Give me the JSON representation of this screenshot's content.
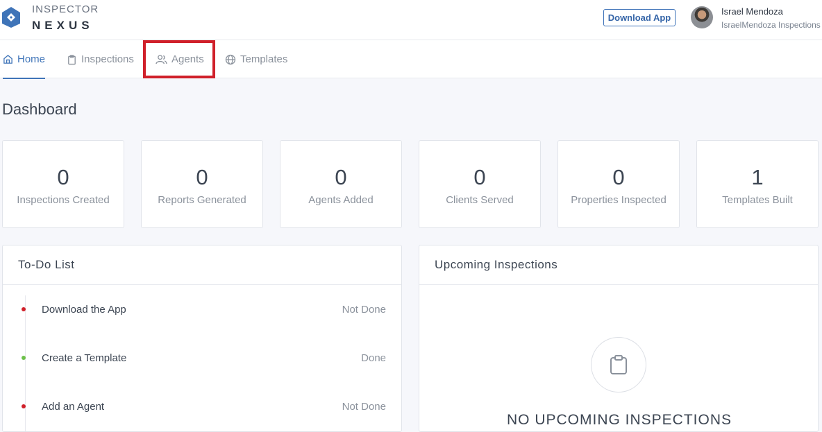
{
  "brand": {
    "line1": "INSPECTOR",
    "line2": "NEXUS",
    "color": "#3f74b8"
  },
  "header": {
    "download_label": "Download App",
    "user_name": "Israel Mendoza",
    "user_company": "IsraelMendoza Inspections"
  },
  "nav": {
    "items": [
      {
        "label": "Home",
        "icon": "home-icon",
        "active": true
      },
      {
        "label": "Inspections",
        "icon": "clipboard-icon"
      },
      {
        "label": "Agents",
        "icon": "users-icon"
      },
      {
        "label": "Templates",
        "icon": "globe-icon"
      }
    ]
  },
  "dashboard": {
    "title": "Dashboard",
    "stats": [
      {
        "value": "0",
        "label": "Inspections Created"
      },
      {
        "value": "0",
        "label": "Reports Generated"
      },
      {
        "value": "0",
        "label": "Agents Added"
      },
      {
        "value": "0",
        "label": "Clients Served"
      },
      {
        "value": "0",
        "label": "Properties Inspected"
      },
      {
        "value": "1",
        "label": "Templates Built"
      }
    ]
  },
  "todo": {
    "title": "To-Do List",
    "items": [
      {
        "label": "Download the App",
        "status": "Not Done",
        "dot_color": "#d0202a"
      },
      {
        "label": "Create a Template",
        "status": "Done",
        "dot_color": "#6cc04a"
      },
      {
        "label": "Add an Agent",
        "status": "Not Done",
        "dot_color": "#d0202a"
      }
    ]
  },
  "upcoming": {
    "title": "Upcoming Inspections",
    "empty_text": "NO UPCOMING INSPECTIONS",
    "empty_icon": "clipboard-icon"
  }
}
